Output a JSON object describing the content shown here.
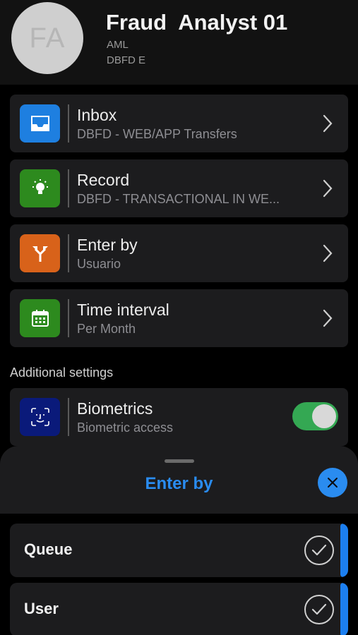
{
  "profile": {
    "initials": "FA",
    "name": "Fraud  Analyst 01",
    "line1": "AML",
    "line2": "DBFD E"
  },
  "menu": [
    {
      "title": "Inbox",
      "subtitle": "DBFD - WEB/APP Transfers",
      "icon": "inbox-tray-icon",
      "color": "#1e7fe0"
    },
    {
      "title": "Record",
      "subtitle": "DBFD - TRANSACTIONAL IN WE...",
      "icon": "lightbulb-icon",
      "color": "#2d8a1e"
    },
    {
      "title": "Enter by",
      "subtitle": "Usuario",
      "icon": "fork-arrow-icon",
      "color": "#d8621a"
    },
    {
      "title": "Time interval",
      "subtitle": "Per Month",
      "icon": "calendar-icon",
      "color": "#2d8a1e"
    }
  ],
  "additional_settings_label": "Additional settings",
  "biometrics": {
    "title": "Biometrics",
    "subtitle": "Biometric access",
    "icon": "face-id-icon",
    "color": "#0a1a7a",
    "enabled": true
  },
  "sheet": {
    "title": "Enter by",
    "options": [
      {
        "label": "Queue"
      },
      {
        "label": "User"
      }
    ]
  },
  "colors": {
    "accent": "#2a8cf0",
    "toggle_on": "#34a853"
  }
}
